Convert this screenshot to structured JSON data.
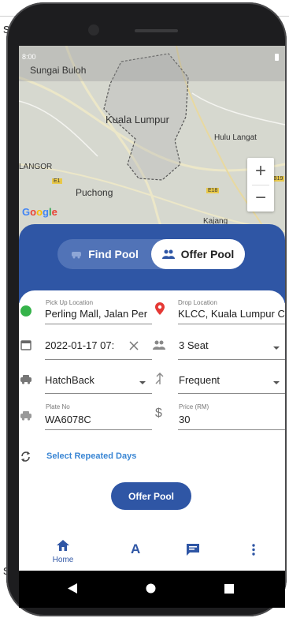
{
  "page_fragment_top": "s",
  "page_fragment_bottom": "s",
  "status_time": "8:00",
  "map": {
    "labels": [
      "Sungai Buloh",
      "Kuala Lumpur",
      "Hulu Langat",
      "LANGOR",
      "Puchong",
      "Kajang"
    ],
    "road_badges": [
      "E1",
      "E18",
      "B19"
    ],
    "zoom_in": "+",
    "zoom_out": "−",
    "attribution": [
      "G",
      "o",
      "o",
      "g",
      "l",
      "e"
    ],
    "attribution_colors": [
      "#4285F4",
      "#EA4335",
      "#FBBC05",
      "#4285F4",
      "#34A853",
      "#EA4335"
    ]
  },
  "toggle": {
    "find_label": "Find Pool",
    "offer_label": "Offer Pool"
  },
  "form": {
    "pickup_label": "Pick Up Location",
    "pickup_value": "Perling Mall, Jalan Per",
    "drop_label": "Drop Location",
    "drop_value": "KLCC, Kuala Lumpur C",
    "datetime_value": "2022-01-17 07:",
    "seats_value": "3 Seat",
    "car_type_value": "HatchBack",
    "frequency_value": "Frequent",
    "plate_label": "Plate No",
    "plate_value": "WA6078C",
    "price_label": "Price (RM)",
    "price_value": "30",
    "repeat_label": "Select Repeated Days",
    "submit_label": "Offer Pool"
  },
  "bottom_nav": {
    "home_label": "Home",
    "middle_icon": "A"
  },
  "colors": {
    "primary": "#2f56a5",
    "accent_link": "#3a86d4",
    "pickup_dot": "#35b34a",
    "drop_pin": "#e53935"
  }
}
